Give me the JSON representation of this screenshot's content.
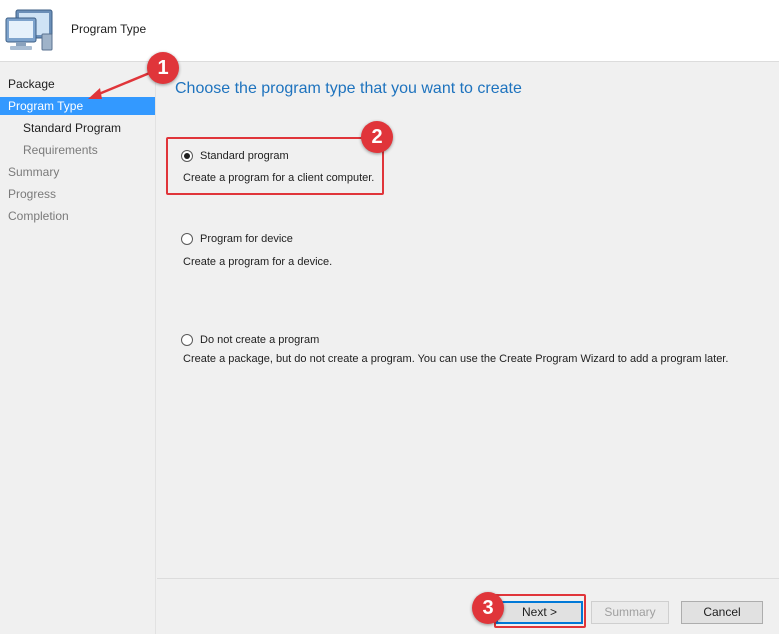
{
  "header": {
    "title": "Program Type",
    "icon": "computer-monitor-icon"
  },
  "sidebar": {
    "items": [
      {
        "label": "Package"
      },
      {
        "label": "Program Type"
      },
      {
        "label": "Standard Program"
      },
      {
        "label": "Requirements"
      },
      {
        "label": "Summary"
      },
      {
        "label": "Progress"
      },
      {
        "label": "Completion"
      }
    ]
  },
  "main": {
    "heading": "Choose the program type that you want to create",
    "options": [
      {
        "label": "Standard program",
        "description": "Create a program for a client computer.",
        "selected": true
      },
      {
        "label": "Program for device",
        "description": "Create a program for a device.",
        "selected": false
      },
      {
        "label": "Do not create a program",
        "description": "Create a package, but do not create a program. You can use the Create Program Wizard to add a program later.",
        "selected": false
      }
    ]
  },
  "footer": {
    "next_label": "Next >",
    "summary_label": "Summary",
    "cancel_label": "Cancel"
  },
  "annotations": {
    "badges": [
      "1",
      "2",
      "3"
    ],
    "color": "#e0353a"
  }
}
